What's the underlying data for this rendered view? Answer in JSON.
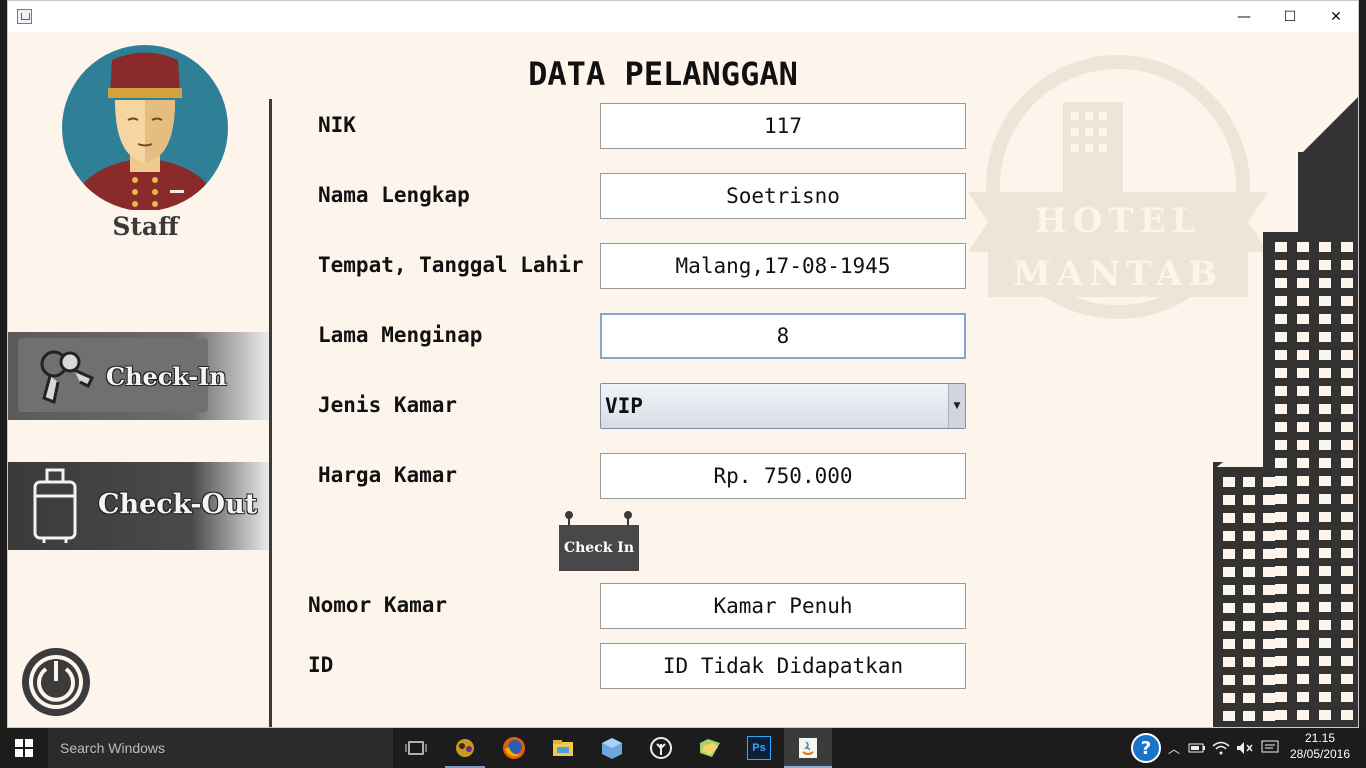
{
  "window": {
    "title": "",
    "controls": {
      "minimize": "—",
      "maximize": "☐",
      "close": "✕"
    }
  },
  "sidebar": {
    "staff_label": "Staff",
    "menu": [
      {
        "label": "Check-In",
        "icon": "keys-icon"
      },
      {
        "label": "Check-Out",
        "icon": "suitcase-icon"
      }
    ],
    "power_icon": "power-icon"
  },
  "form": {
    "title": "DATA PELANGGAN",
    "nik": {
      "label": "NIK",
      "value": "117"
    },
    "nama": {
      "label": "Nama Lengkap",
      "value": "Soetrisno"
    },
    "ttl": {
      "label": "Tempat, Tanggal Lahir",
      "value": "Malang,17-08-1945"
    },
    "lama": {
      "label": "Lama Menginap",
      "value": "8"
    },
    "jenis": {
      "label": "Jenis Kamar",
      "value": "VIP"
    },
    "harga": {
      "label": "Harga Kamar",
      "value": "Rp. 750.000"
    },
    "checkin_button": "Check In",
    "nomor": {
      "label": "Nomor Kamar",
      "value": "Kamar Penuh"
    },
    "id": {
      "label": "ID",
      "value": "ID Tidak Didapatkan"
    }
  },
  "watermark": {
    "line1": "HOTEL",
    "line2": "MANTAB"
  },
  "taskbar": {
    "search_placeholder": "Search Windows",
    "apps": [
      "task-view-icon",
      "game-icon",
      "firefox-icon",
      "file-explorer-icon",
      "box-icon",
      "tree-icon",
      "folder-icon",
      "photoshop-icon",
      "java-icon"
    ],
    "photoshop_label": "Ps",
    "time": "21.15",
    "date": "28/05/2016"
  },
  "colors": {
    "background": "#fdf5ec",
    "dark": "#3b3b3b",
    "accent_teal": "#2f7f96",
    "taskbar": "#1c1c1c"
  }
}
